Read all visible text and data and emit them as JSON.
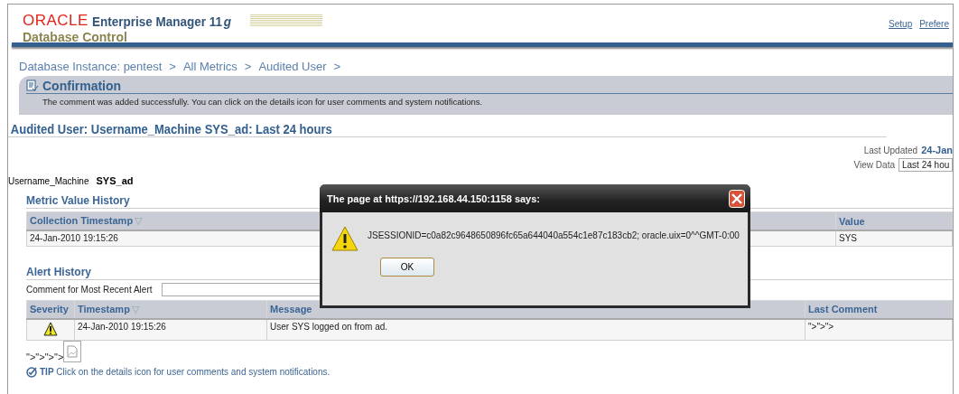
{
  "header": {
    "logo": "ORACLE",
    "product": "Enterprise Manager 11",
    "version_suffix": "g",
    "subtitle": "Database Control",
    "links": [
      "Setup",
      "Prefere"
    ]
  },
  "breadcrumbs": {
    "items": [
      "Database Instance: pentest",
      "All Metrics",
      "Audited User"
    ],
    "separator": ">"
  },
  "confirmation": {
    "title": "Confirmation",
    "message": "The comment was added successfully. You can click on the details icon for user comments and system notifications."
  },
  "page_title": "Audited User: Username_Machine SYS_ad: Last 24 hours",
  "last_updated": {
    "label": "Last Updated",
    "value": "24-Jan"
  },
  "view_data": {
    "label": "View Data",
    "value": "Last 24 hou"
  },
  "key_value": {
    "label": "Username_Machine",
    "value": "SYS_ad"
  },
  "metric_history": {
    "title": "Metric Value History",
    "columns": [
      {
        "label": "Collection Timestamp",
        "sort_mark": "▽"
      },
      {
        "label": "Value"
      }
    ],
    "rows": [
      [
        "24-Jan-2010 19:15:26",
        "SYS"
      ]
    ]
  },
  "alert_history": {
    "title": "Alert History",
    "comment_label": "Comment for Most Recent Alert",
    "columns": [
      {
        "label": "Severity"
      },
      {
        "label": "Timestamp",
        "sort_mark": "▽"
      },
      {
        "label": "Message"
      },
      {
        "label": "Last Comment"
      }
    ],
    "rows": [
      {
        "kind": "warning",
        "timestamp": "24-Jan-2010 19:15:26",
        "message": "User SYS logged on from ad.",
        "last_comment": "\">\">\">"
      }
    ],
    "trailing_text": "\">\">\">\">"
  },
  "tip": {
    "label": "TIP",
    "text": "Click on the details icon for user comments and system notifications."
  },
  "dialog": {
    "title": "The page at https://192.168.44.150:1158 says:",
    "message": "JSESSIONID=c0a82c9648650896fc65a644040a554c1e87c183cb2; oracle.uix=0^^GMT-0:00",
    "button": "OK"
  }
}
